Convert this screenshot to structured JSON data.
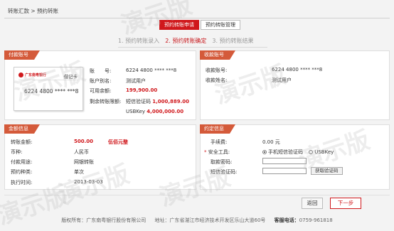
{
  "breadcrumb": "转账汇款 > 预约转账",
  "tabs": [
    {
      "label": "预约转账申请",
      "active": true
    },
    {
      "label": "预约转账管理",
      "active": false
    }
  ],
  "steps": [
    {
      "label": "1. 预约转账录入",
      "active": false
    },
    {
      "label": "2. 预约转账确定",
      "active": true
    },
    {
      "label": "3. 预约转账结果",
      "active": false
    }
  ],
  "payer": {
    "title": "付款账号",
    "card": {
      "bank_name": "广东南粤银行",
      "type": "借记卡",
      "number": "6224 4800 **** ***8"
    },
    "account_label": "账　　号:",
    "account_value": "6224 4800 **** ***8",
    "alias_label": "账户别名:",
    "alias_value": "测试用户",
    "balance_label": "可用余额:",
    "balance_value": "199,900.00",
    "limit_label": "剩余转账限额:",
    "limit_sms_label": "短信验证码",
    "limit_sms_value": "1,000,889.00",
    "limit_usbkey_label": "USBKey",
    "limit_usbkey_value": "4,000,000.00"
  },
  "payee": {
    "title": "收款账号",
    "account_label": "收款账号:",
    "account_value": "6224 4800 **** ***8",
    "name_label": "收款姓名:",
    "name_value": "测试用户"
  },
  "amount": {
    "title": "金额信息",
    "transfer_amount_label": "转账金额:",
    "transfer_amount_value": "500.00",
    "transfer_amount_caps": "伍佰元整",
    "currency_label": "币种:",
    "currency_value": "人民币",
    "method_label": "付款用途:",
    "method_value": "网银转账",
    "type_label": "预约种类:",
    "type_value": "单次",
    "exec_label": "执行时间:",
    "exec_value": "2013-03-03"
  },
  "verify": {
    "title": "约定信息",
    "fee_label": "手续费:",
    "fee_value": "0.00 元",
    "tool_label": "安全工具:",
    "tool_options": [
      "手机短信验证码",
      "USBKey"
    ],
    "tool_selected": "手机短信验证码",
    "password_label": "取款密码:",
    "sms_label": "短信验证码:",
    "sms_button": "获取验证码"
  },
  "actions": {
    "back": "返回",
    "next": "下一步"
  },
  "footer": {
    "copyright": "版权所有：广东南粤银行股份有限公司",
    "address": "地址：广东省湛江市经济技术开发区乐山大道60号",
    "hotline_label": "客服电话：",
    "hotline_value": "0759-961818"
  },
  "watermark": "演示版"
}
